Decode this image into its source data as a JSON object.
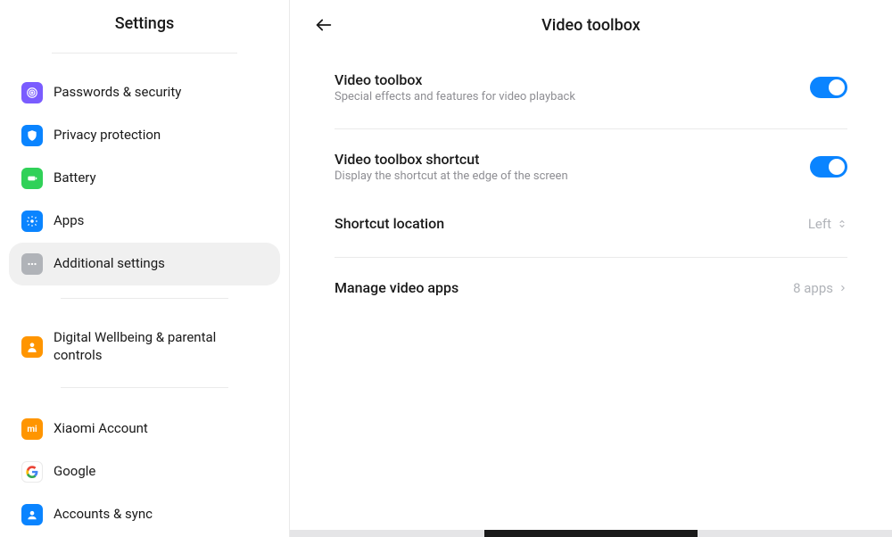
{
  "colors": {
    "accent": "#0a84ff",
    "muted": "#8e8e93"
  },
  "sidebar": {
    "title": "Settings",
    "items": [
      {
        "label": "Passwords & security"
      },
      {
        "label": "Privacy protection"
      },
      {
        "label": "Battery"
      },
      {
        "label": "Apps"
      },
      {
        "label": "Additional settings",
        "active": true
      },
      {
        "label": "Digital Wellbeing & parental controls"
      },
      {
        "label": "Xiaomi Account"
      },
      {
        "label": "Google"
      },
      {
        "label": "Accounts & sync"
      }
    ]
  },
  "main": {
    "title": "Video toolbox",
    "rows": [
      {
        "key": "video_toolbox",
        "title": "Video toolbox",
        "subtitle": "Special effects and features for video playback",
        "type": "toggle",
        "value": true
      },
      {
        "key": "shortcut",
        "title": "Video toolbox shortcut",
        "subtitle": "Display the shortcut at the edge of the screen",
        "type": "toggle",
        "value": true
      },
      {
        "key": "shortcut_location",
        "title": "Shortcut location",
        "type": "select",
        "value": "Left"
      },
      {
        "key": "manage_apps",
        "title": "Manage video apps",
        "type": "link",
        "value": "8 apps"
      }
    ]
  }
}
